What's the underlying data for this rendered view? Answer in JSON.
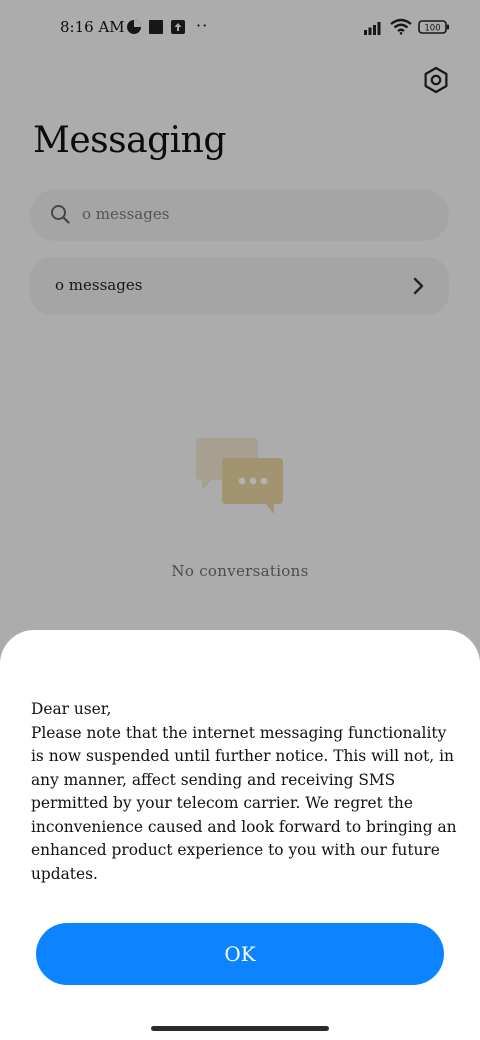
{
  "status_bar": {
    "time": "8:16 AM",
    "more": "··"
  },
  "header": {
    "title": "Messaging",
    "settings_icon": "gear-icon"
  },
  "search": {
    "placeholder": "o messages"
  },
  "row": {
    "label": "o messages"
  },
  "empty_state": {
    "text": "No conversations"
  },
  "dialog": {
    "greeting": "Dear user,",
    "body": "Please note that the internet messaging functionality is now suspended until further notice. This will not, in any manner, affect sending and receiving SMS permitted by your telecom carrier. We regret the inconvenience caused and look forward to bringing an enhanced product experience to you with our future updates.",
    "ok_label": "OK"
  },
  "colors": {
    "accent": "#0d84ff",
    "sheet_bg": "#ffffff"
  }
}
